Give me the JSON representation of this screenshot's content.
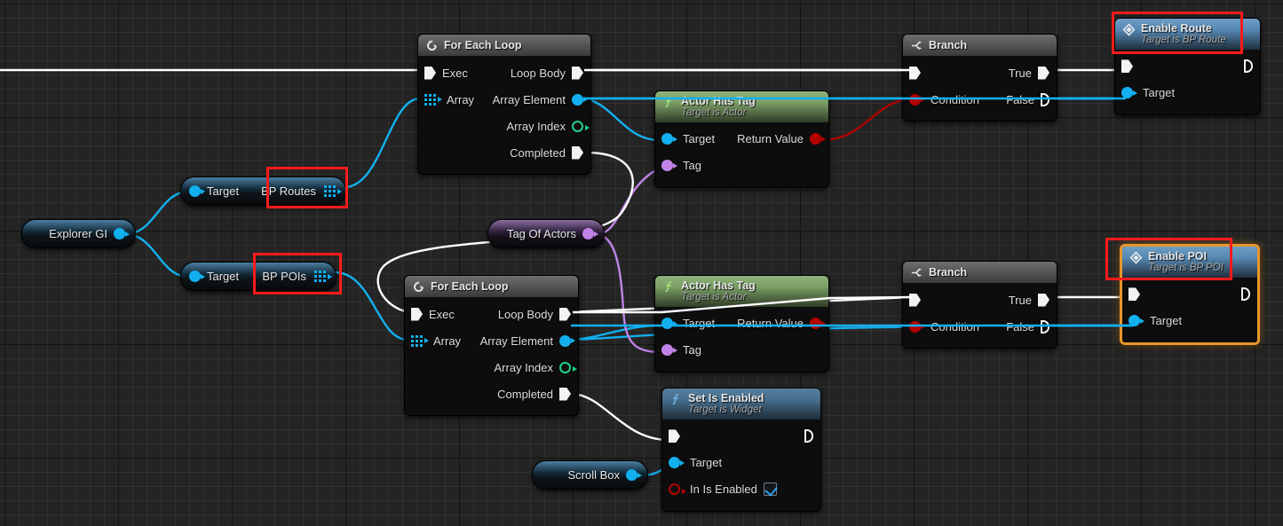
{
  "app": {
    "kind": "blueprint-graph",
    "colors": {
      "canvas": "#242424",
      "exec_wire": "#ffffff",
      "object_wire": "#12b0ef",
      "bool_wire": "#b50000",
      "name_wire": "#c183e8",
      "annotation": "#ff1b1b",
      "selection": "#e8962b"
    }
  },
  "nodes": {
    "explorer_gi": {
      "label": "Explorer GI"
    },
    "target_routes": {
      "label": "Target"
    },
    "bp_routes": {
      "label": "BP Routes"
    },
    "target_pois": {
      "label": "Target"
    },
    "bp_pois": {
      "label": "BP POIs"
    },
    "tag_of_actors": {
      "label": "Tag Of Actors"
    },
    "scroll_box": {
      "label": "Scroll Box"
    },
    "loop_routes": {
      "title": "For Each Loop",
      "icon": "loop-icon",
      "pins_in": [
        {
          "label": "Exec",
          "type": "exec"
        },
        {
          "label": "Array",
          "type": "array"
        }
      ],
      "pins_out": [
        {
          "label": "Loop Body",
          "type": "exec"
        },
        {
          "label": "Array Element",
          "type": "object"
        },
        {
          "label": "Array Index",
          "type": "int"
        },
        {
          "label": "Completed",
          "type": "exec"
        }
      ]
    },
    "loop_pois": {
      "title": "For Each Loop",
      "icon": "loop-icon",
      "pins_in": [
        {
          "label": "Exec",
          "type": "exec"
        },
        {
          "label": "Array",
          "type": "array"
        }
      ],
      "pins_out": [
        {
          "label": "Loop Body",
          "type": "exec"
        },
        {
          "label": "Array Element",
          "type": "object"
        },
        {
          "label": "Array Index",
          "type": "int"
        },
        {
          "label": "Completed",
          "type": "exec"
        }
      ]
    },
    "has_tag_routes": {
      "title": "Actor Has Tag",
      "subtitle": "Target is Actor",
      "icon": "function-icon",
      "pins_in": [
        {
          "label": "Target",
          "type": "object"
        },
        {
          "label": "Tag",
          "type": "name"
        }
      ],
      "pins_out": [
        {
          "label": "Return Value",
          "type": "bool"
        }
      ]
    },
    "has_tag_pois": {
      "title": "Actor Has Tag",
      "subtitle": "Target is Actor",
      "icon": "function-icon",
      "pins_in": [
        {
          "label": "Target",
          "type": "object"
        },
        {
          "label": "Tag",
          "type": "name"
        }
      ],
      "pins_out": [
        {
          "label": "Return Value",
          "type": "bool"
        }
      ]
    },
    "branch_routes": {
      "title": "Branch",
      "icon": "branch-icon",
      "pins_in": [
        {
          "label": "",
          "type": "exec"
        },
        {
          "label": "Condition",
          "type": "bool"
        }
      ],
      "pins_out": [
        {
          "label": "True",
          "type": "exec"
        },
        {
          "label": "False",
          "type": "exec-unconnected"
        }
      ]
    },
    "branch_pois": {
      "title": "Branch",
      "icon": "branch-icon",
      "pins_in": [
        {
          "label": "",
          "type": "exec"
        },
        {
          "label": "Condition",
          "type": "bool"
        }
      ],
      "pins_out": [
        {
          "label": "True",
          "type": "exec"
        },
        {
          "label": "False",
          "type": "exec-unconnected"
        }
      ]
    },
    "enable_route": {
      "title": "Enable Route",
      "subtitle": "Target is BP Route",
      "icon": "event-icon",
      "selected": false,
      "pins_in": [
        {
          "label": "",
          "type": "exec"
        },
        {
          "label": "Target",
          "type": "object"
        }
      ],
      "pins_out": [
        {
          "label": "",
          "type": "exec-unconnected"
        }
      ]
    },
    "enable_poi": {
      "title": "Enable POI",
      "subtitle": "Target is BP POI",
      "icon": "event-icon",
      "selected": true,
      "pins_in": [
        {
          "label": "",
          "type": "exec"
        },
        {
          "label": "Target",
          "type": "object"
        }
      ],
      "pins_out": [
        {
          "label": "",
          "type": "exec-unconnected"
        }
      ]
    },
    "set_is_enabled": {
      "title": "Set Is Enabled",
      "subtitle": "Target is Widget",
      "icon": "function-icon",
      "pins_in": [
        {
          "label": "",
          "type": "exec"
        },
        {
          "label": "Target",
          "type": "object"
        },
        {
          "label": "In Is Enabled",
          "type": "bool-ring",
          "value": true
        }
      ],
      "pins_out": [
        {
          "label": "",
          "type": "exec-unconnected"
        }
      ]
    }
  },
  "annotations": [
    {
      "name": "bp-routes-highlight"
    },
    {
      "name": "bp-pois-highlight"
    },
    {
      "name": "enable-route-highlight"
    },
    {
      "name": "enable-poi-highlight"
    }
  ]
}
